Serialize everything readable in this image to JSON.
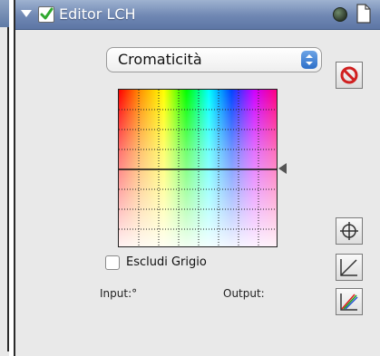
{
  "window": {
    "title": "Editor LCH",
    "enabled": true
  },
  "channel_select": {
    "selected": "Cromaticità"
  },
  "exclude_gray": {
    "label": "Escludi Grigio",
    "checked": false
  },
  "readout": {
    "input_label": "Input:°",
    "output_label": "Output:"
  },
  "icons": {
    "disclosure": "disclosure-triangle-icon",
    "enable": "checkmark-icon",
    "status": "status-led-icon",
    "page": "page-icon",
    "reset": "prohibit-icon",
    "crosshair": "crosshair-icon",
    "curve": "curve-icon",
    "multicurve": "multicolor-curve-icon"
  },
  "colors": {
    "titlebar": "#6f87b3",
    "check_green": "#2fa82f",
    "reset_red": "#d02020"
  }
}
